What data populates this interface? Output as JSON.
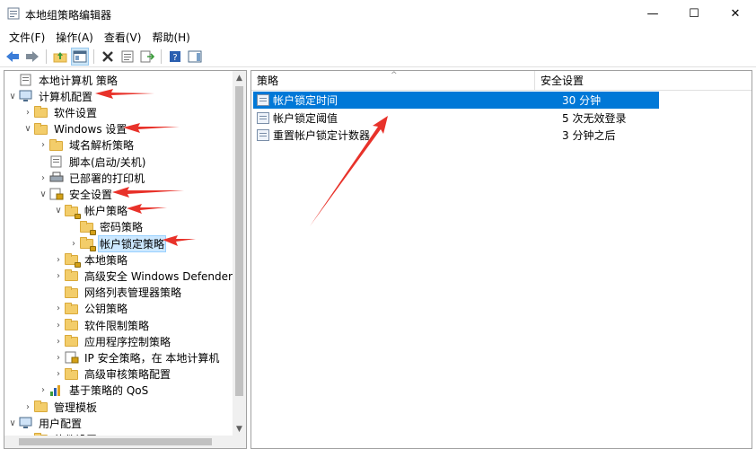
{
  "window": {
    "title": "本地组策略编辑器",
    "controls": {
      "minimize": "—",
      "maximize": "☐",
      "close": "✕"
    }
  },
  "menu": [
    "文件(F)",
    "操作(A)",
    "查看(V)",
    "帮助(H)"
  ],
  "tree": [
    {
      "label": "本地计算机 策略",
      "level": 0,
      "expander": "",
      "icon": "policy-icon"
    },
    {
      "label": "计算机配置",
      "level": 0,
      "expander": "∨",
      "icon": "computer-icon"
    },
    {
      "label": "软件设置",
      "level": 1,
      "expander": "›",
      "icon": "folder-icon"
    },
    {
      "label": "Windows 设置",
      "level": 1,
      "expander": "∨",
      "icon": "folder-icon"
    },
    {
      "label": "域名解析策略",
      "level": 2,
      "expander": "›",
      "icon": "folder-icon"
    },
    {
      "label": "脚本(启动/关机)",
      "level": 2,
      "expander": "",
      "icon": "script-icon"
    },
    {
      "label": "已部署的打印机",
      "level": 2,
      "expander": "›",
      "icon": "printer-icon"
    },
    {
      "label": "安全设置",
      "level": 2,
      "expander": "∨",
      "icon": "security-icon"
    },
    {
      "label": "帐户策略",
      "level": 3,
      "expander": "∨",
      "icon": "folder-lock-icon"
    },
    {
      "label": "密码策略",
      "level": 4,
      "expander": "",
      "icon": "folder-lock-icon"
    },
    {
      "label": "帐户锁定策略",
      "level": 4,
      "expander": "›",
      "icon": "folder-lock-icon",
      "selected": true
    },
    {
      "label": "本地策略",
      "level": 3,
      "expander": "›",
      "icon": "folder-lock-icon"
    },
    {
      "label": "高级安全 Windows Defender 防火",
      "level": 3,
      "expander": "›",
      "icon": "folder-icon"
    },
    {
      "label": "网络列表管理器策略",
      "level": 3,
      "expander": "",
      "icon": "folder-icon"
    },
    {
      "label": "公钥策略",
      "level": 3,
      "expander": "›",
      "icon": "folder-icon"
    },
    {
      "label": "软件限制策略",
      "level": 3,
      "expander": "›",
      "icon": "folder-icon"
    },
    {
      "label": "应用程序控制策略",
      "level": 3,
      "expander": "›",
      "icon": "folder-icon"
    },
    {
      "label": "IP 安全策略，在 本地计算机",
      "level": 3,
      "expander": "›",
      "icon": "ipsec-icon"
    },
    {
      "label": "高级审核策略配置",
      "level": 3,
      "expander": "›",
      "icon": "folder-icon"
    },
    {
      "label": "基于策略的 QoS",
      "level": 2,
      "expander": "›",
      "icon": "chart-icon"
    },
    {
      "label": "管理模板",
      "level": 1,
      "expander": "›",
      "icon": "folder-icon"
    },
    {
      "label": "用户配置",
      "level": 0,
      "expander": "∨",
      "icon": "user-icon"
    },
    {
      "label": "软件设置",
      "level": 1,
      "expander": "›",
      "icon": "folder-icon"
    }
  ],
  "list": {
    "columns": [
      "策略",
      "安全设置"
    ],
    "rows": [
      {
        "name": "帐户锁定时间",
        "value": "30 分钟",
        "selected": true
      },
      {
        "name": "帐户锁定阈值",
        "value": "5 次无效登录"
      },
      {
        "name": "重置帐户锁定计数器",
        "value": "3 分钟之后"
      }
    ]
  },
  "colors": {
    "selection": "#0078d7",
    "annotation": "#e8322a",
    "tree_selection": "#cce8ff"
  }
}
